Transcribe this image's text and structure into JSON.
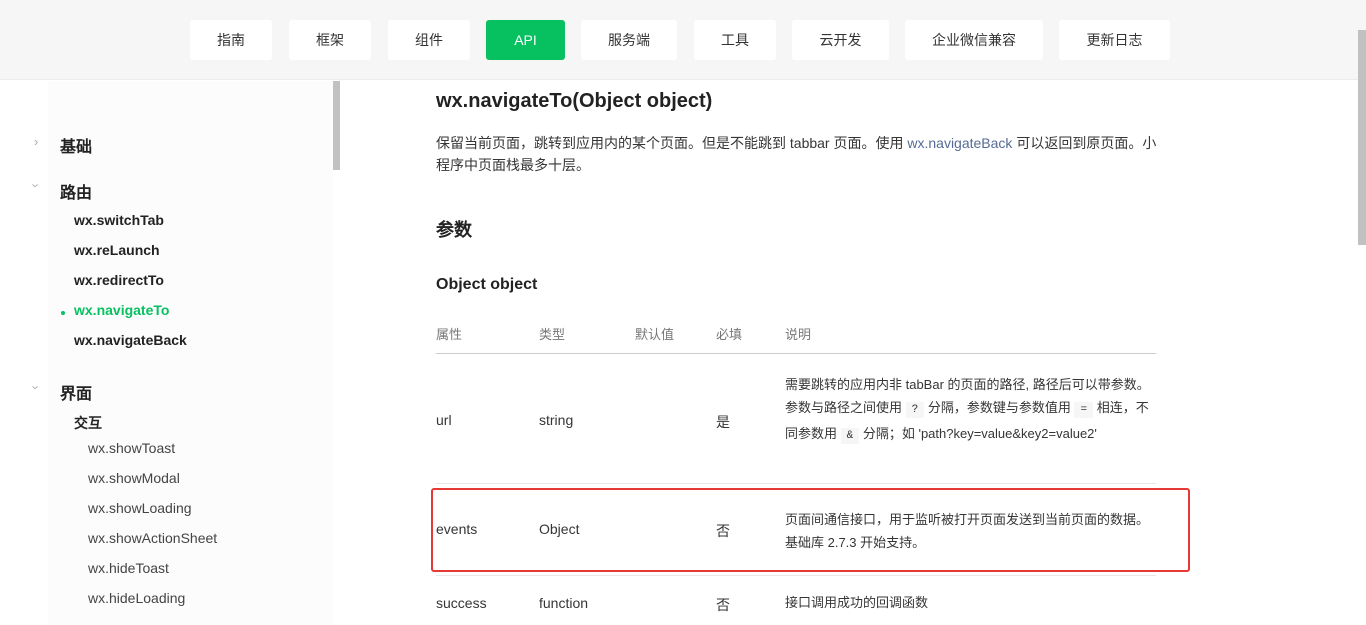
{
  "nav": [
    "指南",
    "框架",
    "组件",
    "API",
    "服务端",
    "工具",
    "云开发",
    "企业微信兼容",
    "更新日志"
  ],
  "sidebar": {
    "groups": [
      {
        "label": "基础",
        "expanded": false
      },
      {
        "label": "路由",
        "expanded": true
      },
      {
        "label": "界面",
        "expanded": true
      }
    ],
    "route_items": [
      "wx.switchTab",
      "wx.reLaunch",
      "wx.redirectTo",
      "wx.navigateTo",
      "wx.navigateBack"
    ],
    "ui_sub": "交互",
    "ui_items": [
      "wx.showToast",
      "wx.showModal",
      "wx.showLoading",
      "wx.showActionSheet",
      "wx.hideToast",
      "wx.hideLoading"
    ]
  },
  "content": {
    "title": "wx.navigateTo(Object object)",
    "desc_a": "保留当前页面，跳转到应用内的某个页面。但是不能跳到 tabbar 页面。使用 ",
    "desc_link": "wx.navigateBack",
    "desc_b": " 可以返回到原页面。小程序中页面栈最多十层。",
    "params_heading": "参数",
    "object_heading": "Object object",
    "headers": [
      "属性",
      "类型",
      "默认值",
      "必填",
      "说明"
    ],
    "rows": [
      {
        "name": "url",
        "type": "string",
        "required": "是",
        "d1": "需要跳转的应用内非 tabBar 的页面的路径, 路径后可以带参数。参数与路径之间使用 ",
        "c1": "?",
        "d2": " 分隔，参数键与参数值用 ",
        "c2": "=",
        "d3": " 相连，不同参数用 ",
        "c3": "&",
        "d4": " 分隔；如 'path?key=value&key2=value2'"
      },
      {
        "name": "events",
        "type": "Object",
        "required": "否",
        "desc": "页面间通信接口，用于监听被打开页面发送到当前页面的数据。基础库 2.7.3 开始支持。"
      },
      {
        "name": "success",
        "type": "function",
        "required": "否",
        "desc": "接口调用成功的回调函数"
      }
    ]
  },
  "colors": {
    "accent": "#07c160",
    "highlight": "#e53935",
    "link": "#576b95"
  }
}
